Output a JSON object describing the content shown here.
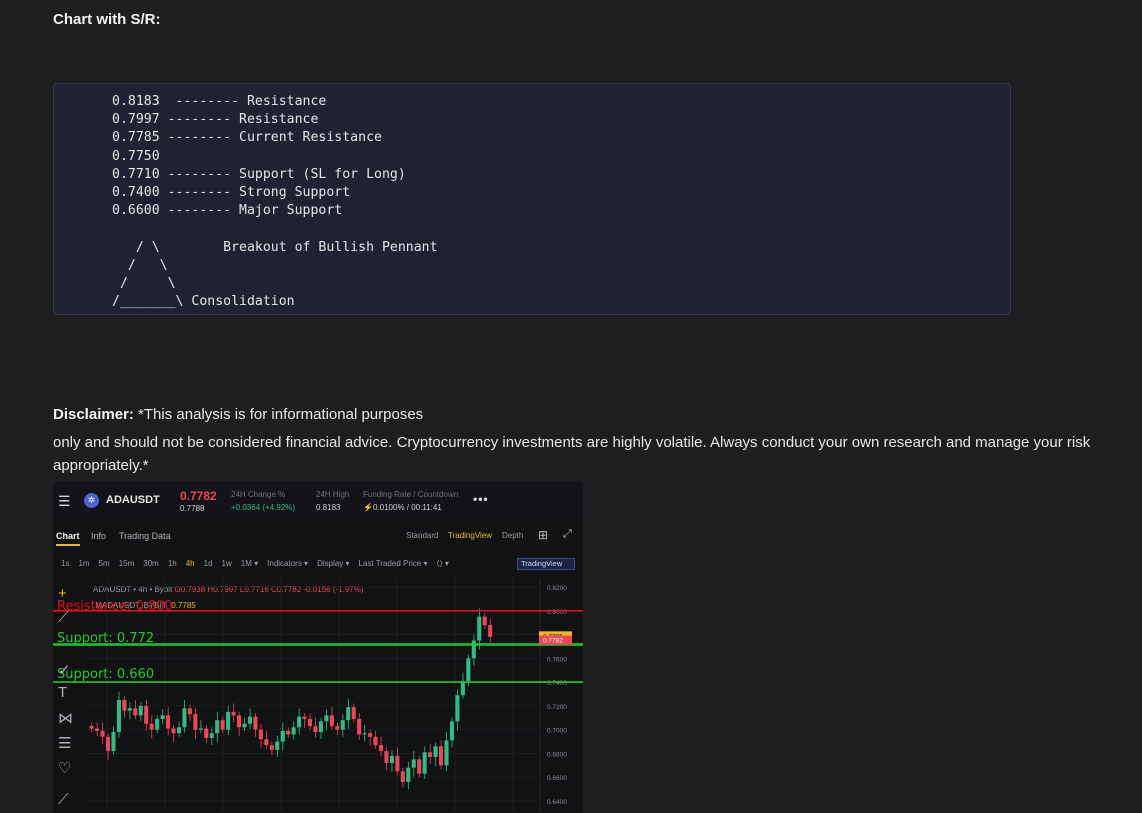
{
  "heading": "Chart with S/R:",
  "code_lines": [
    "0.8183  -------- Resistance",
    "0.7997 -------- Resistance",
    "0.7785 -------- Current Resistance",
    "0.7750",
    "0.7710 -------- Support (SL for Long)",
    "0.7400 -------- Strong Support",
    "0.6600 -------- Major Support",
    "",
    "   / \\        Breakout of Bullish Pennant",
    "  /   \\",
    " /     \\",
    "/_______\\ Consolidation"
  ],
  "disclaimer": {
    "label": "Disclaimer:",
    "line1": " *This analysis is for informational purposes",
    "rest": "only and should not be considered financial advice.  Cryptocurrency investments are highly volatile.  Always conduct your own research and manage your risk appropriately.*"
  },
  "screenshot": {
    "menu_icon": "menu-icon",
    "pair": "ADAUSDT",
    "last_price": "0.7782",
    "mark_price": "0.7788",
    "stats": [
      {
        "label": "24H Change %",
        "value": "+0.0364 (+4.92%)"
      },
      {
        "label": "24H High",
        "value": "0.8183"
      },
      {
        "label": "Funding Rate / Countdown",
        "value": "0.0100% / 00:11:41"
      }
    ],
    "tabs": [
      "Chart",
      "Info",
      "Trading Data"
    ],
    "views": [
      "Standard",
      "TradingView",
      "Depth"
    ],
    "intervals": [
      "1s",
      "1m",
      "5m",
      "15m",
      "30m",
      "1h",
      "4h",
      "1d",
      "1w",
      "1M ▾",
      "Indicators ▾",
      "Display ▾",
      "Last Traded Price ▾",
      "⟨⟩ ▾"
    ],
    "tv_badge": "TradingView",
    "legend1_prefix": "ADAUSDT • 4h • Bybit",
    "legend1_ohlc": "O0.7938 H0.7997 L0.7716 C0.7782 -0.0156 (-1.97%)",
    "legend2_prefix": ".MADAUSDT, BYBIT",
    "legend2_value": "0.7785",
    "overlay_labels": {
      "resistance": "Resistance: 0.800",
      "support1": "Support: 0.772",
      "support2": "Support: 0.660"
    },
    "price_tags": [
      "0.7785",
      "0.7782"
    ],
    "colors": {
      "up": "#2ebd85",
      "down": "#f0445a",
      "accent": "#f0b90b",
      "overlay_red": "#e0101a",
      "overlay_green": "#22cc22"
    },
    "chart_data": {
      "type": "candlestick",
      "title": "",
      "ylim": [
        0.63,
        0.825
      ],
      "y_ticks": [
        "0.8200",
        "0.8000",
        "0.7800",
        "0.7600",
        "0.7400",
        "0.7200",
        "0.7000",
        "0.6800",
        "0.6600",
        "0.6400"
      ],
      "lines": [
        {
          "name": "Resistance",
          "value": 0.8,
          "color": "#e0101a"
        },
        {
          "name": "Support",
          "value": 0.772,
          "color": "#22cc22"
        },
        {
          "name": "Support",
          "value": 0.74,
          "color": "#22cc22"
        }
      ],
      "closes": [
        0.701,
        0.699,
        0.694,
        0.682,
        0.698,
        0.725,
        0.716,
        0.718,
        0.712,
        0.72,
        0.705,
        0.7,
        0.709,
        0.712,
        0.701,
        0.697,
        0.702,
        0.718,
        0.713,
        0.7,
        0.701,
        0.693,
        0.697,
        0.708,
        0.7,
        0.715,
        0.712,
        0.702,
        0.705,
        0.711,
        0.7,
        0.692,
        0.687,
        0.683,
        0.69,
        0.699,
        0.696,
        0.702,
        0.711,
        0.709,
        0.703,
        0.698,
        0.707,
        0.712,
        0.703,
        0.7,
        0.708,
        0.719,
        0.709,
        0.696,
        0.697,
        0.694,
        0.687,
        0.682,
        0.672,
        0.678,
        0.665,
        0.656,
        0.668,
        0.675,
        0.663,
        0.681,
        0.677,
        0.686,
        0.67,
        0.691,
        0.707,
        0.729,
        0.741,
        0.76,
        0.775,
        0.795,
        0.788,
        0.778
      ]
    }
  }
}
